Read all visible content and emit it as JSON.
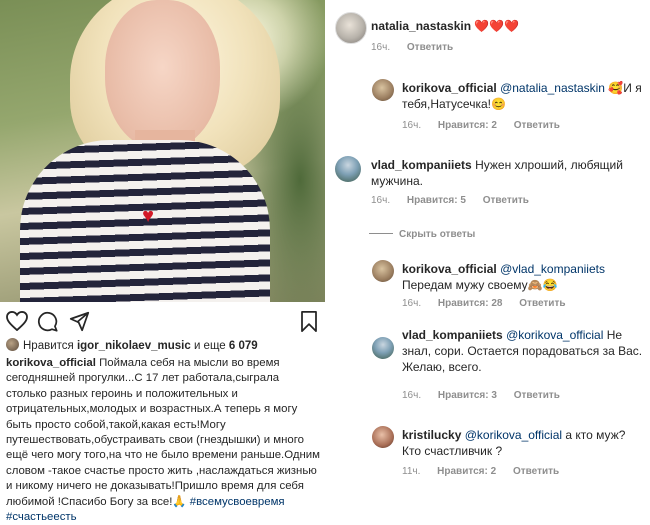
{
  "post": {
    "likes": {
      "prefix": "Нравится",
      "user": "igor_nikolaev_music",
      "and_more": "и еще",
      "count": "6 079"
    },
    "caption": {
      "author": "korikova_official",
      "text": "Поймала себя на мысли во время сегодняшней прогулки...С 17 лет работала,сыграла столько разных героинь и положительных и отрицательных,молодых и возрастных.А теперь я могу быть просто собой,такой,какая есть!Могу путешествовать,обустраивать свои (гнездышки) и много ещё чего могу того,на что не было времени раньше.Одним словом -такое счастье просто жить ,наслаждаться жизнью и никому ничего не доказывать!Пришло  время для себя любимой !Спасибо Богу за все!",
      "hashtags": "#всемусвоевремя #счастьеесть"
    }
  },
  "comments": [
    {
      "user": "natalia_nastaskin",
      "text": "❤️❤️❤️",
      "time": "16ч.",
      "reply": "Ответить"
    },
    {
      "user": "korikova_official",
      "mention": "@natalia_nastaskin",
      "text": "🥰И я тебя,Натусечка!😊",
      "time": "16ч.",
      "likes": "Нравится: 2",
      "reply": "Ответить"
    },
    {
      "user": "vlad_kompaniiets",
      "text": "Нужен хлроший, любящий мужчина.",
      "time": "16ч.",
      "likes": "Нравится: 5",
      "reply": "Ответить"
    },
    {
      "user": "korikova_official",
      "mention": "@vlad_kompaniiets",
      "text": "Передам мужу своему🙈😂",
      "time": "16ч.",
      "likes": "Нравится: 28",
      "reply": "Ответить"
    },
    {
      "user": "vlad_kompaniiets",
      "mention": "@korikova_official",
      "text": "Не знал, сори. Остается порадоваться за Вас. Желаю, всего.",
      "time": "16ч.",
      "likes": "Нравится: 3",
      "reply": "Ответить"
    },
    {
      "user": "kristilucky",
      "mention": "@korikova_official",
      "text": "а кто муж? Кто счастливчик ?",
      "time": "11ч.",
      "likes": "Нравится: 2",
      "reply": "Ответить"
    }
  ],
  "hide_replies": "Скрыть ответы",
  "icons": [
    "heart-icon",
    "comment-icon",
    "share-icon",
    "bookmark-icon"
  ]
}
